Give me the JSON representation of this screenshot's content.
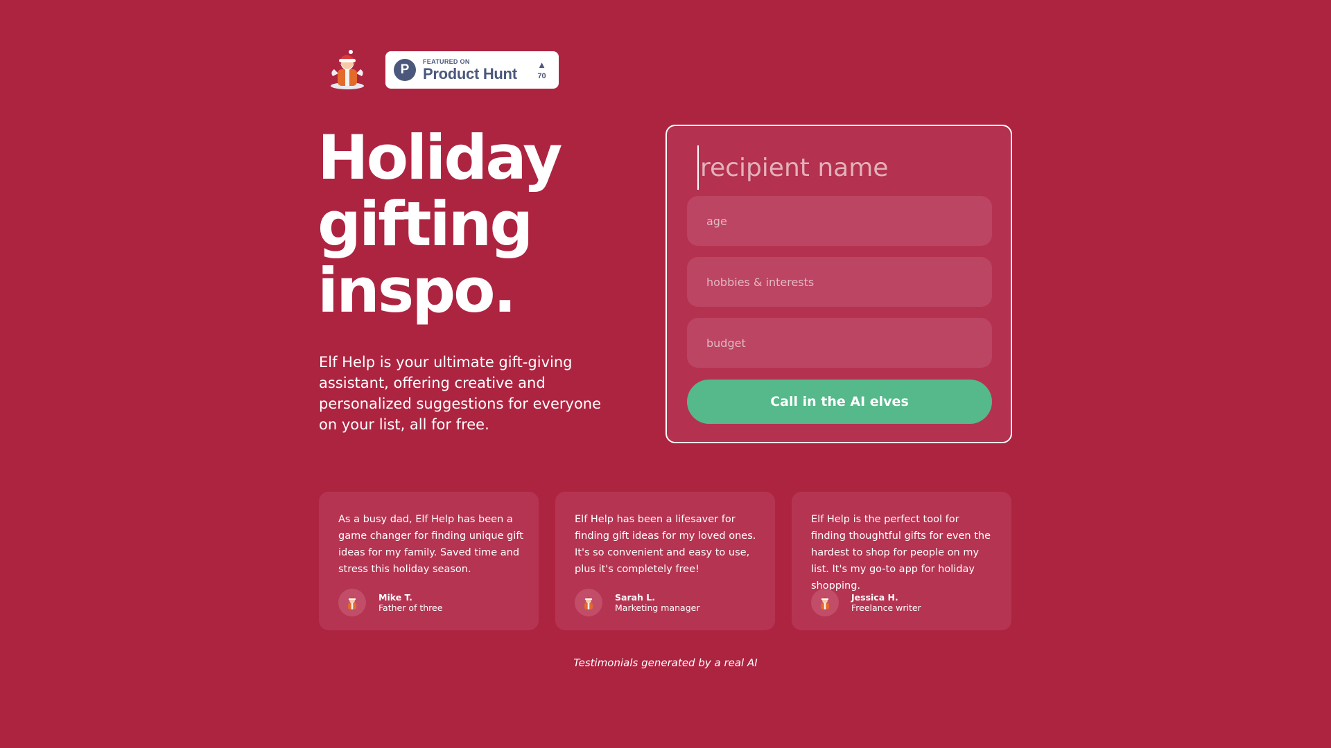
{
  "brand": {
    "logo_icon": "santa-elf-mascot-icon",
    "background_color": "#ad2441",
    "accent_green": "#55b98b"
  },
  "product_hunt": {
    "featured_label": "FEATURED ON",
    "name": "Product Hunt",
    "letter": "P",
    "upvote_icon": "triangle-up-icon",
    "votes": "70"
  },
  "hero": {
    "title_lines": [
      "Holiday",
      "gifting",
      "inspo."
    ],
    "description": "Elf Help is your ultimate gift-giving assistant, offering creative and personalized suggestions for everyone on your list, all for free."
  },
  "form": {
    "recipient_placeholder": "recipient name",
    "age_placeholder": "age",
    "hobbies_placeholder": "hobbies & interests",
    "budget_placeholder": "budget",
    "submit_label": "Call in the AI elves"
  },
  "testimonials": [
    {
      "quote": "As a busy dad, Elf Help has been a game changer for finding unique gift ideas for my family. Saved time and stress this holiday season.",
      "name": "Mike T.",
      "role": "Father of three"
    },
    {
      "quote": "Elf Help has been a lifesaver for finding gift ideas for my loved ones. It's so convenient and easy to use, plus it's completely free!",
      "name": "Sarah L.",
      "role": "Marketing manager"
    },
    {
      "quote": "Elf Help is the perfect tool for finding thoughtful gifts for even the hardest to shop for people on my list. It's my go-to app for holiday shopping.",
      "name": "Jessica H.",
      "role": "Freelance writer"
    }
  ],
  "footnote": "Testimonials generated by a real AI"
}
